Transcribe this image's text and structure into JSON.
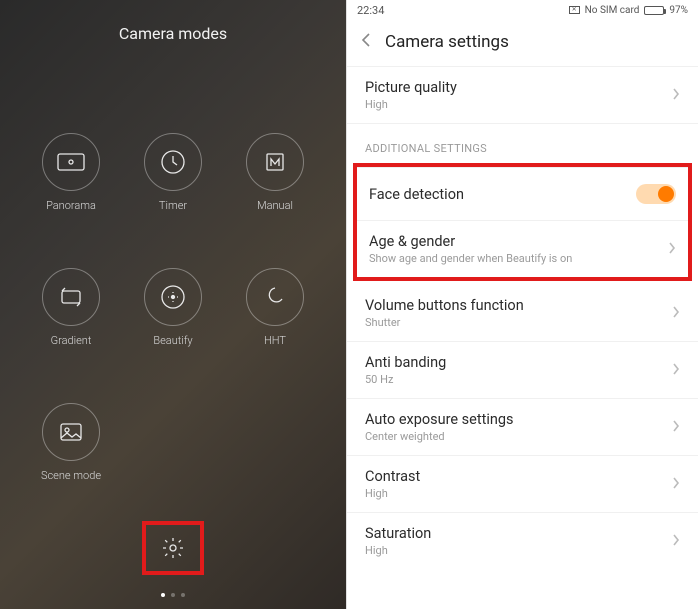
{
  "left": {
    "title": "Camera modes",
    "modes": [
      {
        "name": "panorama",
        "label": "Panorama"
      },
      {
        "name": "timer",
        "label": "Timer"
      },
      {
        "name": "manual",
        "label": "Manual"
      },
      {
        "name": "gradient",
        "label": "Gradient"
      },
      {
        "name": "beautify",
        "label": "Beautify"
      },
      {
        "name": "hht",
        "label": "HHT"
      },
      {
        "name": "scene-mode",
        "label": "Scene mode"
      }
    ]
  },
  "right": {
    "status": {
      "time": "22:34",
      "sim": "No SIM card",
      "battery": "97%"
    },
    "header": "Camera settings",
    "rows": {
      "picture_quality": {
        "label": "Picture quality",
        "sub": "High"
      },
      "section_additional": "ADDITIONAL SETTINGS",
      "face_detection": {
        "label": "Face detection"
      },
      "age_gender": {
        "label": "Age & gender",
        "sub": "Show age and gender when Beautify is on"
      },
      "volume_buttons": {
        "label": "Volume buttons function",
        "sub": "Shutter"
      },
      "anti_banding": {
        "label": "Anti banding",
        "sub": "50 Hz"
      },
      "auto_exposure": {
        "label": "Auto exposure settings",
        "sub": "Center weighted"
      },
      "contrast": {
        "label": "Contrast",
        "sub": "High"
      },
      "saturation": {
        "label": "Saturation",
        "sub": "High"
      }
    }
  }
}
